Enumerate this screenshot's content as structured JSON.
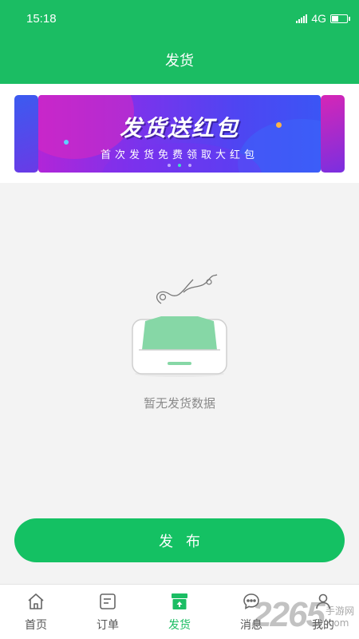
{
  "status_bar": {
    "time": "15:18",
    "network": "4G"
  },
  "header": {
    "title": "发货"
  },
  "banner": {
    "title": "发货送红包",
    "subtitle": "首次发货免费领取大红包",
    "page_count": 3,
    "active_page": 2
  },
  "empty_state": {
    "message": "暂无发货数据"
  },
  "publish_button": {
    "label": "发布"
  },
  "tabbar": {
    "items": [
      {
        "label": "首页",
        "icon": "home-icon",
        "active": false
      },
      {
        "label": "订单",
        "icon": "order-icon",
        "active": false
      },
      {
        "label": "发货",
        "icon": "ship-icon",
        "active": true
      },
      {
        "label": "消息",
        "icon": "message-icon",
        "active": false
      },
      {
        "label": "我的",
        "icon": "profile-icon",
        "active": false
      }
    ]
  },
  "watermark": {
    "number": "2265",
    "line1": "手游网",
    "line2": ".com"
  },
  "colors": {
    "primary": "#1bbd63",
    "background": "#f3f3f3",
    "empty_text": "#8a8a8a"
  }
}
